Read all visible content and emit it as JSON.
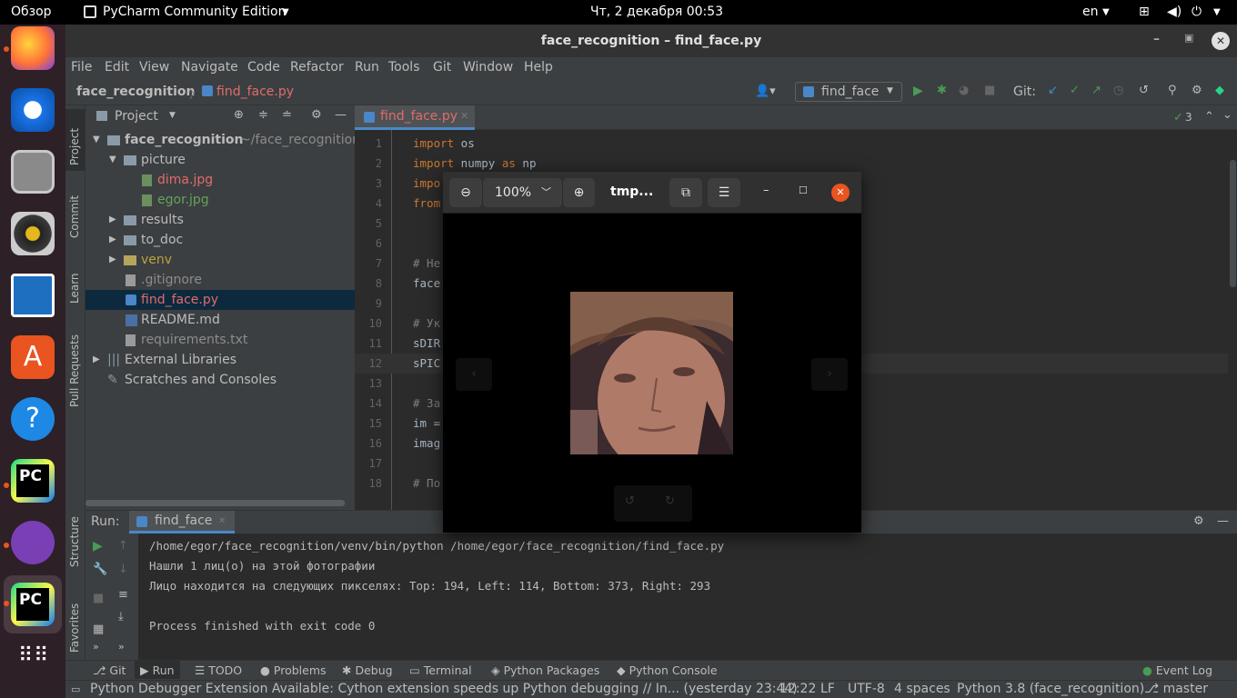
{
  "topbar": {
    "overview": "Обзор",
    "app_name": "PyCharm Community Edition",
    "datetime": "Чт, 2 декабря  00:53",
    "lang": "en"
  },
  "window": {
    "title": "face_recognition – find_face.py"
  },
  "menu": [
    "File",
    "Edit",
    "View",
    "Navigate",
    "Code",
    "Refactor",
    "Run",
    "Tools",
    "Git",
    "Window",
    "Help"
  ],
  "nav": {
    "project": "face_recognition",
    "file": "find_face.py",
    "run_config": "find_face",
    "git_label": "Git:"
  },
  "side_tabs": {
    "project": "Project",
    "commit": "Commit",
    "learn": "Learn",
    "pull_requests": "Pull Requests",
    "structure": "Structure",
    "favorites": "Favorites"
  },
  "project_panel": {
    "title": "Project",
    "tree": [
      {
        "label": "face_recognition",
        "suffix": "~/face_recognition",
        "type": "folder",
        "open": true
      },
      {
        "label": "picture",
        "type": "folder",
        "open": true
      },
      {
        "label": "dima.jpg",
        "type": "image"
      },
      {
        "label": "egor.jpg",
        "type": "image"
      },
      {
        "label": "results",
        "type": "folder"
      },
      {
        "label": "to_doc",
        "type": "folder"
      },
      {
        "label": "venv",
        "type": "folder"
      },
      {
        "label": ".gitignore",
        "type": "file"
      },
      {
        "label": "find_face.py",
        "type": "py"
      },
      {
        "label": "README.md",
        "type": "md"
      },
      {
        "label": "requirements.txt",
        "type": "file"
      },
      {
        "label": "External Libraries",
        "type": "lib"
      },
      {
        "label": "Scratches and Consoles",
        "type": "scratch"
      }
    ]
  },
  "editor": {
    "tab": "find_face.py",
    "inspections": "3",
    "lines": [
      {
        "n": "1",
        "kw": "import",
        "rest": " os"
      },
      {
        "n": "2",
        "kw": "import",
        "rest": " numpy ",
        "kw2": "as",
        "rest2": " np"
      },
      {
        "n": "3",
        "kw": "impo",
        "rest": ""
      },
      {
        "n": "4",
        "kw": "from",
        "rest": ""
      },
      {
        "n": "5",
        "kw": "",
        "rest": ""
      },
      {
        "n": "6",
        "kw": "",
        "rest": ""
      },
      {
        "n": "7",
        "cm": "# Не"
      },
      {
        "n": "8",
        "kw": "",
        "rest": "face"
      },
      {
        "n": "9",
        "kw": "",
        "rest": ""
      },
      {
        "n": "10",
        "cm": "# Ук"
      },
      {
        "n": "11",
        "kw": "",
        "rest": "sDIR"
      },
      {
        "n": "12",
        "kw": "",
        "rest": "sPIC"
      },
      {
        "n": "13",
        "kw": "",
        "rest": ""
      },
      {
        "n": "14",
        "cm": "# За"
      },
      {
        "n": "15",
        "kw": "",
        "rest": "im ="
      },
      {
        "n": "16",
        "kw": "",
        "rest": "imag"
      },
      {
        "n": "17",
        "kw": "",
        "rest": ""
      },
      {
        "n": "18",
        "cm": "# По"
      }
    ]
  },
  "viewer": {
    "zoom": "100%",
    "title": "tmp..."
  },
  "run": {
    "label": "Run:",
    "tab": "find_face",
    "output": [
      "/home/egor/face_recognition/venv/bin/python /home/egor/face_recognition/find_face.py",
      "Нашли 1 лиц(о) на этой фотографии",
      "Лицо находится на следующих пикселях: Top: 194, Left: 114, Bottom: 373, Right: 293",
      "",
      "Process finished with exit code 0"
    ]
  },
  "bottom_tabs": [
    "Git",
    "Run",
    "TODO",
    "Problems",
    "Debug",
    "Terminal",
    "Python Packages",
    "Python Console"
  ],
  "event_log": "Event Log",
  "status": {
    "message": "Python Debugger Extension Available: Cython extension speeds up Python debugging // In... (yesterday 23:44)",
    "position": "12:22",
    "line_sep": "LF",
    "encoding": "UTF-8",
    "indent": "4 spaces",
    "interpreter": "Python 3.8 (face_recognition)",
    "branch": "master"
  },
  "colors": {
    "accent": "#e95420",
    "run_green": "#499c54",
    "selection": "#0d293e"
  }
}
